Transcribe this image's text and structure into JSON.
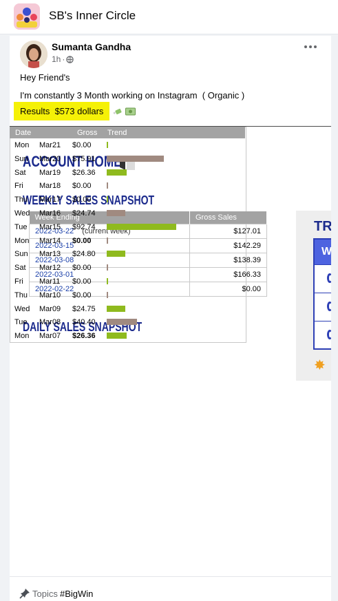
{
  "group": {
    "name": "SB's Inner Circle"
  },
  "post": {
    "author": "Sumanta Gandha",
    "time": "1h",
    "separator": "·",
    "lines": [
      "Hey Friend's",
      "I'm constantly 3 Month working on Instagram  ( Organic )"
    ],
    "results": "Results  $573 dollars",
    "highlight_color": "#f5f107",
    "emojis": [
      "money-with-wings",
      "dollar-banknote"
    ]
  },
  "screenshot": {
    "account_title": "ACCOUNT HOME:",
    "weekly": {
      "title": "WEEKLY SALES SNAPSHOT",
      "headers": [
        "Week Ending",
        "Gross Sales"
      ],
      "rows": [
        {
          "date": "2022-03-22",
          "note": "(current week)",
          "amount": "$127.01"
        },
        {
          "date": "2022-03-15",
          "note": "",
          "amount": "$142.29"
        },
        {
          "date": "2022-03-08",
          "note": "",
          "amount": "$138.39"
        },
        {
          "date": "2022-03-01",
          "note": "",
          "amount": "$166.33"
        },
        {
          "date": "2022-02-22",
          "note": "",
          "amount": "$0.00"
        }
      ]
    },
    "daily": {
      "title": "DAILY SALES SNAPSHOT",
      "headers": [
        "Date",
        "Gross",
        "Trend"
      ],
      "rows": [
        {
          "day": "Mon",
          "date": "Mar21",
          "gross": "$0.00",
          "value": 0,
          "color": "#8fba1e",
          "bold": false
        },
        {
          "day": "Sun",
          "date": "Mar20",
          "gross": "$75.91",
          "value": 75.91,
          "color": "#a08a80",
          "bold": false
        },
        {
          "day": "Sat",
          "date": "Mar19",
          "gross": "$26.36",
          "value": 26.36,
          "color": "#8fba1e",
          "bold": false
        },
        {
          "day": "Fri",
          "date": "Mar18",
          "gross": "$0.00",
          "value": 0,
          "color": "#a08a80",
          "bold": false
        },
        {
          "day": "Thu",
          "date": "Mar17",
          "gross": "$0.00",
          "value": 0,
          "color": "#8fba1e",
          "bold": false
        },
        {
          "day": "Wed",
          "date": "Mar16",
          "gross": "$24.74",
          "value": 24.74,
          "color": "#a08a80",
          "bold": false
        },
        {
          "day": "Tue",
          "date": "Mar15",
          "gross": "$92.74",
          "value": 92.74,
          "color": "#8fba1e",
          "bold": false
        },
        {
          "day": "Mon",
          "date": "Mar14",
          "gross": "$0.00",
          "value": 0,
          "color": "#a08a80",
          "bold": true
        },
        {
          "day": "Sun",
          "date": "Mar13",
          "gross": "$24.80",
          "value": 24.8,
          "color": "#8fba1e",
          "bold": false
        },
        {
          "day": "Sat",
          "date": "Mar12",
          "gross": "$0.00",
          "value": 0,
          "color": "#a08a80",
          "bold": false
        },
        {
          "day": "Fri",
          "date": "Mar11",
          "gross": "$0.00",
          "value": 0,
          "color": "#8fba1e",
          "bold": false
        },
        {
          "day": "Thu",
          "date": "Mar10",
          "gross": "$0.00",
          "value": 0,
          "color": "#a08a80",
          "bold": false
        },
        {
          "day": "Wed",
          "date": "Mar09",
          "gross": "$24.75",
          "value": 24.75,
          "color": "#8fba1e",
          "bold": false
        },
        {
          "day": "Tue",
          "date": "Mar08",
          "gross": "$40.40",
          "value": 40.4,
          "color": "#a08a80",
          "bold": false
        },
        {
          "day": "Mon",
          "date": "Mar07",
          "gross": "$26.36",
          "value": 26.36,
          "color": "#8fba1e",
          "bold": true
        }
      ]
    },
    "side_panel": {
      "title_partial": "TR",
      "header_partial": "W"
    }
  },
  "footer": {
    "topics_label": "Topics",
    "hashtag": "#BigWin"
  }
}
